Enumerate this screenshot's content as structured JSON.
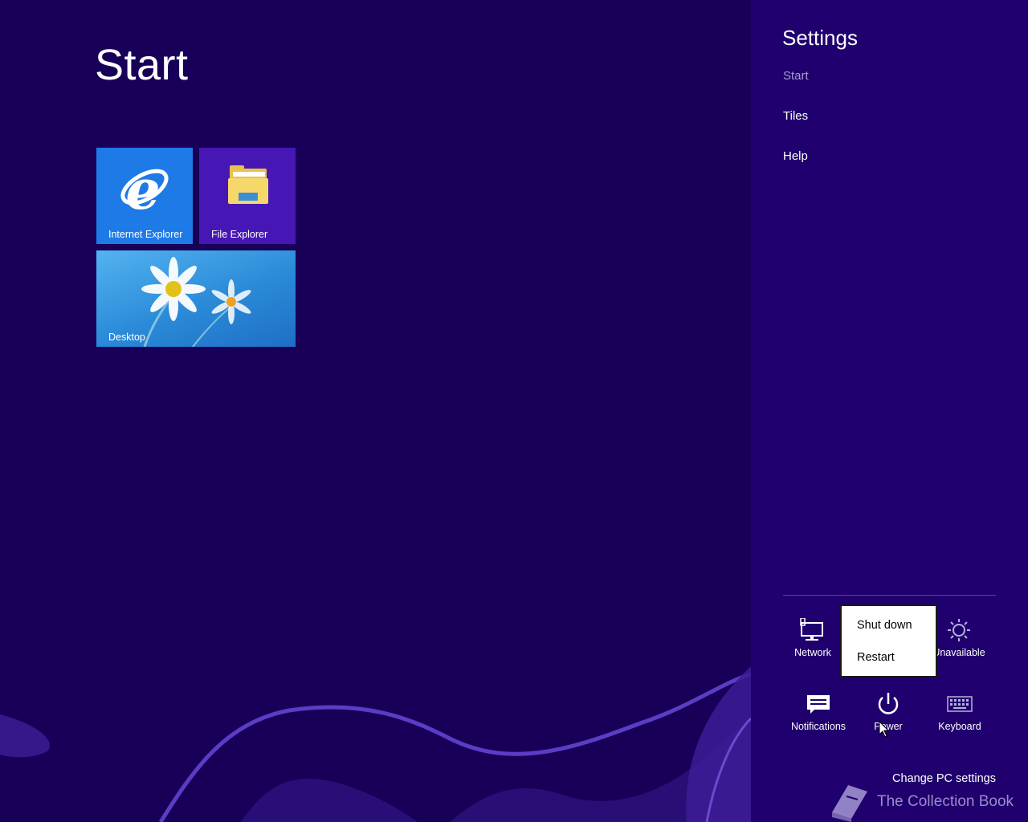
{
  "start": {
    "title": "Start",
    "tiles": [
      {
        "label": "Internet Explorer",
        "icon": "internet-explorer-icon",
        "color": "#1e7ae6"
      },
      {
        "label": "File Explorer",
        "icon": "folder-icon",
        "color": "#4617b4"
      },
      {
        "label": "Desktop",
        "icon": "daisy-wallpaper",
        "color": "#2a8ad8"
      }
    ]
  },
  "settings": {
    "title": "Settings",
    "context_label": "Start",
    "links": [
      "Tiles",
      "Help"
    ],
    "quick_settings": {
      "network": {
        "label": "Network",
        "icon": "network-icon",
        "extra": "2"
      },
      "brightness": {
        "label": "Unavailable",
        "icon": "brightness-icon"
      },
      "notifications": {
        "label": "Notifications",
        "icon": "notifications-icon"
      },
      "power": {
        "label": "Power",
        "icon": "power-icon"
      },
      "keyboard": {
        "label": "Keyboard",
        "icon": "keyboard-icon"
      }
    },
    "power_menu": {
      "items": [
        "Shut down",
        "Restart"
      ]
    },
    "change_pc_settings": "Change PC settings"
  },
  "watermark": {
    "text": "The Collection Book",
    "icon": "book-icon"
  },
  "colors": {
    "background": "#180059",
    "pane": "#20006e",
    "accent_swirl": "#5b3cc4",
    "menu_bg": "#ffffff"
  }
}
